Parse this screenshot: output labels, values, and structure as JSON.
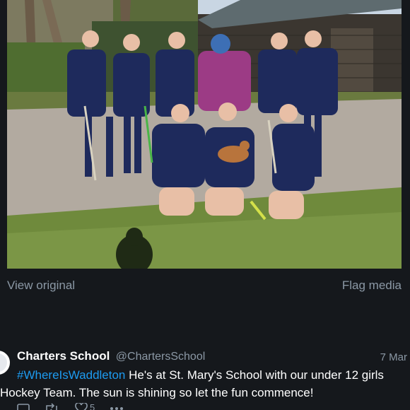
{
  "photo": {
    "alt_description": ""
  },
  "media_actions": {
    "view_original": "View original",
    "flag_media": "Flag media"
  },
  "tweet": {
    "display_name": "Charters School",
    "handle": "@ChartersSchool",
    "timestamp": "7 Mar",
    "hashtag": "#WhereIsWaddleton",
    "text_line1_rest": " He's at St. Mary's School with our under 12 girls",
    "text_line2": "Hockey Team. The sun is shining so let the fun commence!",
    "actions": {
      "like_count": "5"
    }
  },
  "colors": {
    "background": "#15181c",
    "link_blue": "#1d9bf0",
    "muted_text": "#8b98a5"
  }
}
